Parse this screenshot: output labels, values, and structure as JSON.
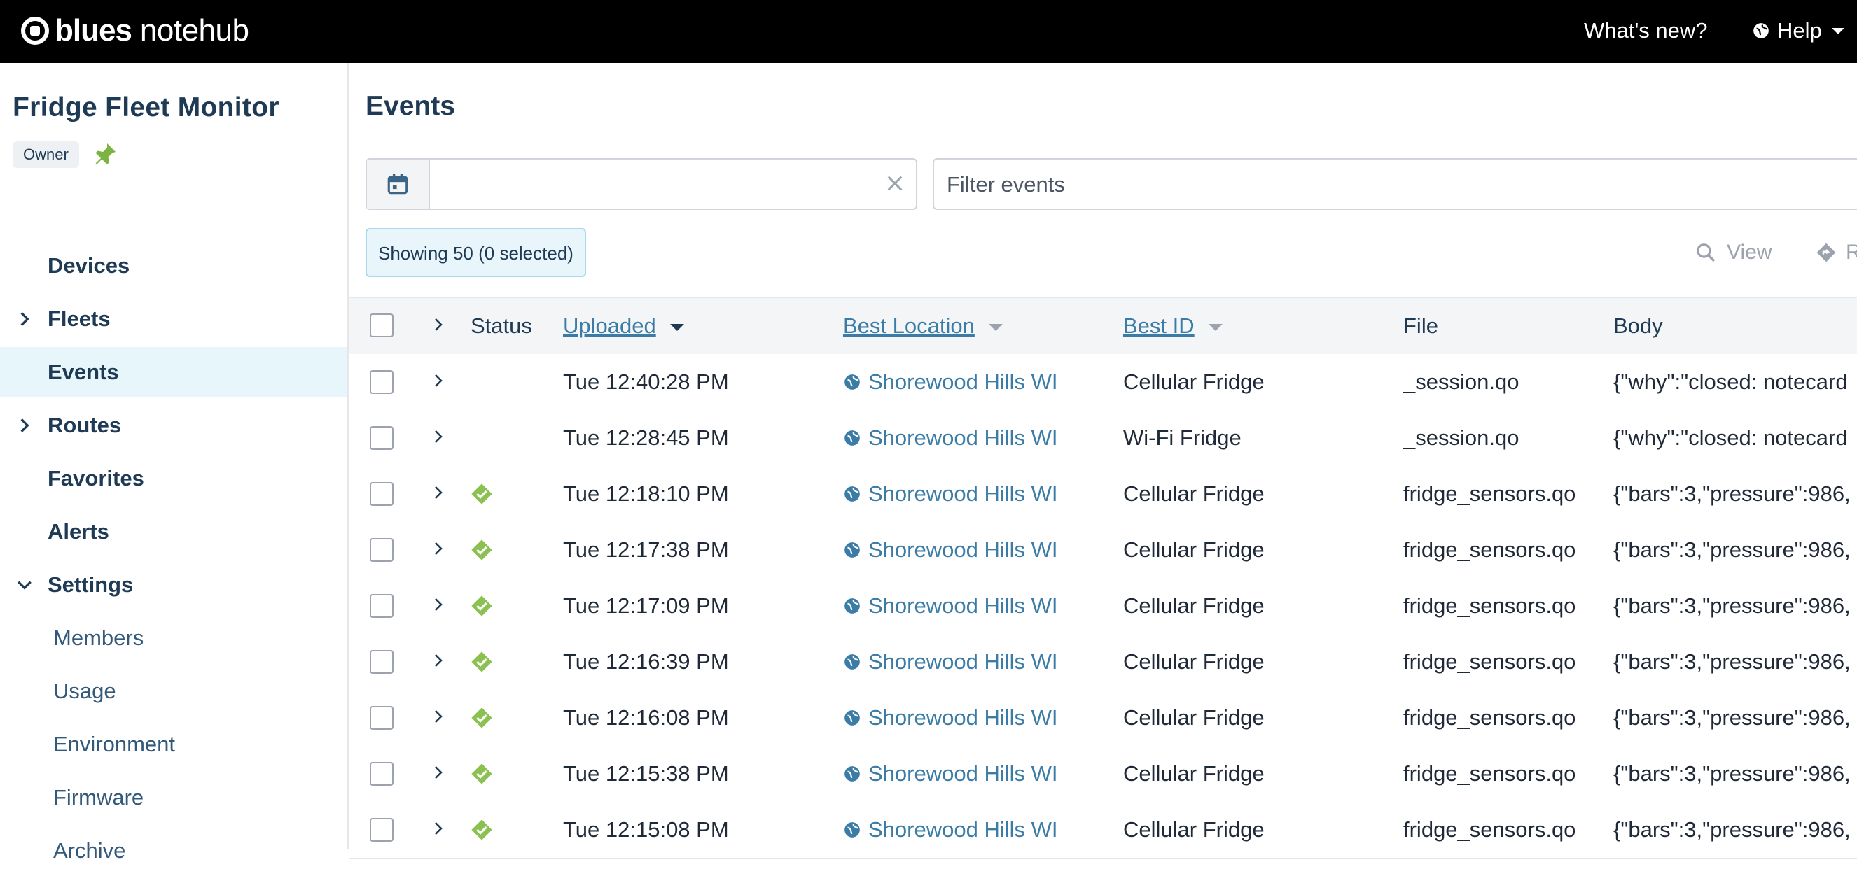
{
  "topbar": {
    "logo_bold": "blues",
    "logo_light": "notehub",
    "whats_new": "What's new?",
    "help": "Help"
  },
  "sidebar": {
    "project_name": "Fridge Fleet Monitor",
    "role_badge": "Owner",
    "items": [
      {
        "label": "Devices"
      },
      {
        "label": "Fleets"
      },
      {
        "label": "Events"
      },
      {
        "label": "Routes"
      },
      {
        "label": "Favorites"
      },
      {
        "label": "Alerts"
      },
      {
        "label": "Settings"
      }
    ],
    "settings_items": [
      {
        "label": "Members"
      },
      {
        "label": "Usage"
      },
      {
        "label": "Environment"
      },
      {
        "label": "Firmware"
      },
      {
        "label": "Archive"
      }
    ]
  },
  "main": {
    "title": "Events",
    "date_value": "",
    "filter_placeholder": "Filter events",
    "showing": "Showing 50 (0 selected)",
    "view_label": "View",
    "r_label": "R"
  },
  "table": {
    "headers": {
      "status": "Status",
      "uploaded": "Uploaded",
      "best_location": "Best Location",
      "best_id": "Best ID",
      "file": "File",
      "body": "Body"
    },
    "rows": [
      {
        "status": "",
        "uploaded": "Tue 12:40:28 PM",
        "location": "Shorewood Hills WI",
        "best_id": "Cellular Fridge",
        "file": "_session.qo",
        "body": "{\"why\":\"closed: notecard"
      },
      {
        "status": "",
        "uploaded": "Tue 12:28:45 PM",
        "location": "Shorewood Hills WI",
        "best_id": "Wi-Fi Fridge",
        "file": "_session.qo",
        "body": "{\"why\":\"closed: notecard"
      },
      {
        "status": "ok",
        "uploaded": "Tue 12:18:10 PM",
        "location": "Shorewood Hills WI",
        "best_id": "Cellular Fridge",
        "file": "fridge_sensors.qo",
        "body": "{\"bars\":3,\"pressure\":986,"
      },
      {
        "status": "ok",
        "uploaded": "Tue 12:17:38 PM",
        "location": "Shorewood Hills WI",
        "best_id": "Cellular Fridge",
        "file": "fridge_sensors.qo",
        "body": "{\"bars\":3,\"pressure\":986,"
      },
      {
        "status": "ok",
        "uploaded": "Tue 12:17:09 PM",
        "location": "Shorewood Hills WI",
        "best_id": "Cellular Fridge",
        "file": "fridge_sensors.qo",
        "body": "{\"bars\":3,\"pressure\":986,"
      },
      {
        "status": "ok",
        "uploaded": "Tue 12:16:39 PM",
        "location": "Shorewood Hills WI",
        "best_id": "Cellular Fridge",
        "file": "fridge_sensors.qo",
        "body": "{\"bars\":3,\"pressure\":986,"
      },
      {
        "status": "ok",
        "uploaded": "Tue 12:16:08 PM",
        "location": "Shorewood Hills WI",
        "best_id": "Cellular Fridge",
        "file": "fridge_sensors.qo",
        "body": "{\"bars\":3,\"pressure\":986,"
      },
      {
        "status": "ok",
        "uploaded": "Tue 12:15:38 PM",
        "location": "Shorewood Hills WI",
        "best_id": "Cellular Fridge",
        "file": "fridge_sensors.qo",
        "body": "{\"bars\":3,\"pressure\":986,"
      },
      {
        "status": "ok",
        "uploaded": "Tue 12:15:08 PM",
        "location": "Shorewood Hills WI",
        "best_id": "Cellular Fridge",
        "file": "fridge_sensors.qo",
        "body": "{\"bars\":3,\"pressure\":986,"
      }
    ]
  },
  "colors": {
    "accent": "#3a7ca5",
    "status_ok": "#8cc152",
    "active_nav_bg": "#e6f6fb",
    "topbar_bg": "#000000"
  },
  "icons": [
    "logo-icon",
    "globe-icon",
    "caret-down-icon",
    "pin-icon",
    "chevron-right-icon",
    "chevron-down-icon",
    "calendar-icon",
    "close-icon",
    "search-icon",
    "route-icon",
    "status-ok-icon"
  ]
}
